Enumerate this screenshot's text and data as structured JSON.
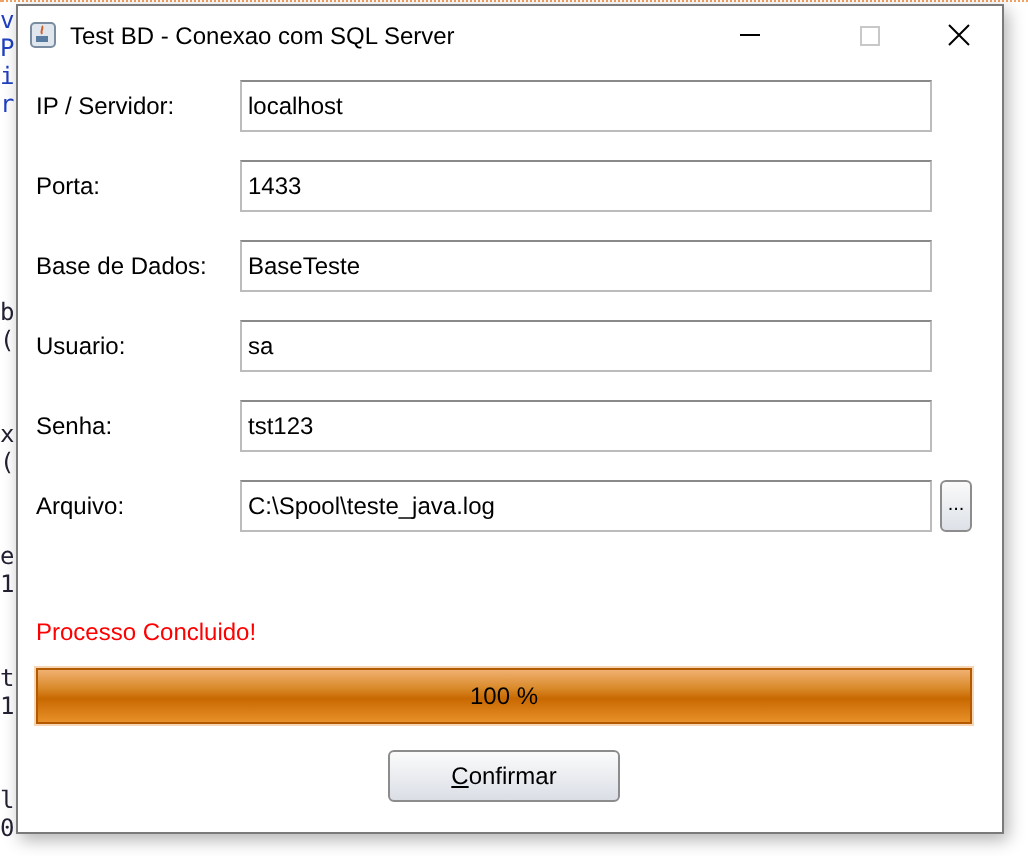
{
  "background_editor": {
    "code_blocks": [
      [
        "v",
        "P",
        "i",
        "r"
      ],
      [
        "b",
        "("
      ],
      [
        "x",
        "("
      ],
      [
        "e",
        "1"
      ],
      [
        "t",
        "1"
      ],
      [
        "l",
        "0"
      ]
    ]
  },
  "window": {
    "title": "Test BD - Conexao com SQL Server"
  },
  "fields": [
    {
      "label": "IP / Servidor:",
      "value": "localhost"
    },
    {
      "label": "Porta:",
      "value": "1433"
    },
    {
      "label": "Base de Dados:",
      "value": "BaseTeste"
    },
    {
      "label": "Usuario:",
      "value": "sa"
    },
    {
      "label": "Senha:",
      "value": "tst123"
    },
    {
      "label": "Arquivo:",
      "value": "C:\\Spool\\teste_java.log",
      "browse_button": "..."
    }
  ],
  "status_message": "Processo Concluido!",
  "progress": {
    "level": 1,
    "reading": "100 %"
  },
  "confirm_button": {
    "label": "Confirmar",
    "mnemonic_underlined": true
  }
}
